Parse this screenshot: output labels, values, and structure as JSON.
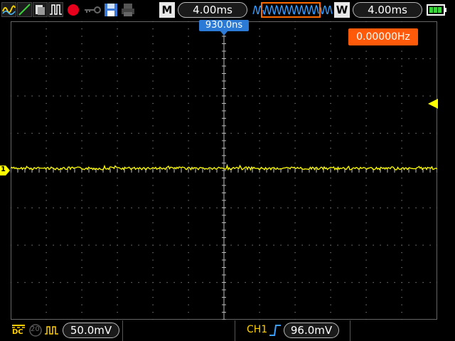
{
  "header": {
    "mode_letter": "M",
    "main_timebase": "4.00ms",
    "window_letter": "W",
    "window_timebase": "4.00ms"
  },
  "trigger": {
    "position": "930.0ns"
  },
  "frequency": {
    "readout": "0.00000Hz"
  },
  "channel1": {
    "marker": "1",
    "coupling": "DC",
    "bandwidth_limit": "20",
    "scale": "50.0mV"
  },
  "trigger_status": {
    "source": "CH1",
    "level": "96.0mV"
  },
  "colors": {
    "trace": "#ffff00",
    "grid_dots": "#8a8a8a",
    "trigger_marker": "#2a7ad6",
    "freq_box": "#ff5a0a"
  },
  "icons": [
    "waveform-icon",
    "ramp-icon",
    "save-icon",
    "pulse-icon",
    "record-icon",
    "key-icon",
    "disk-icon",
    "printer-icon",
    "battery-icon"
  ]
}
